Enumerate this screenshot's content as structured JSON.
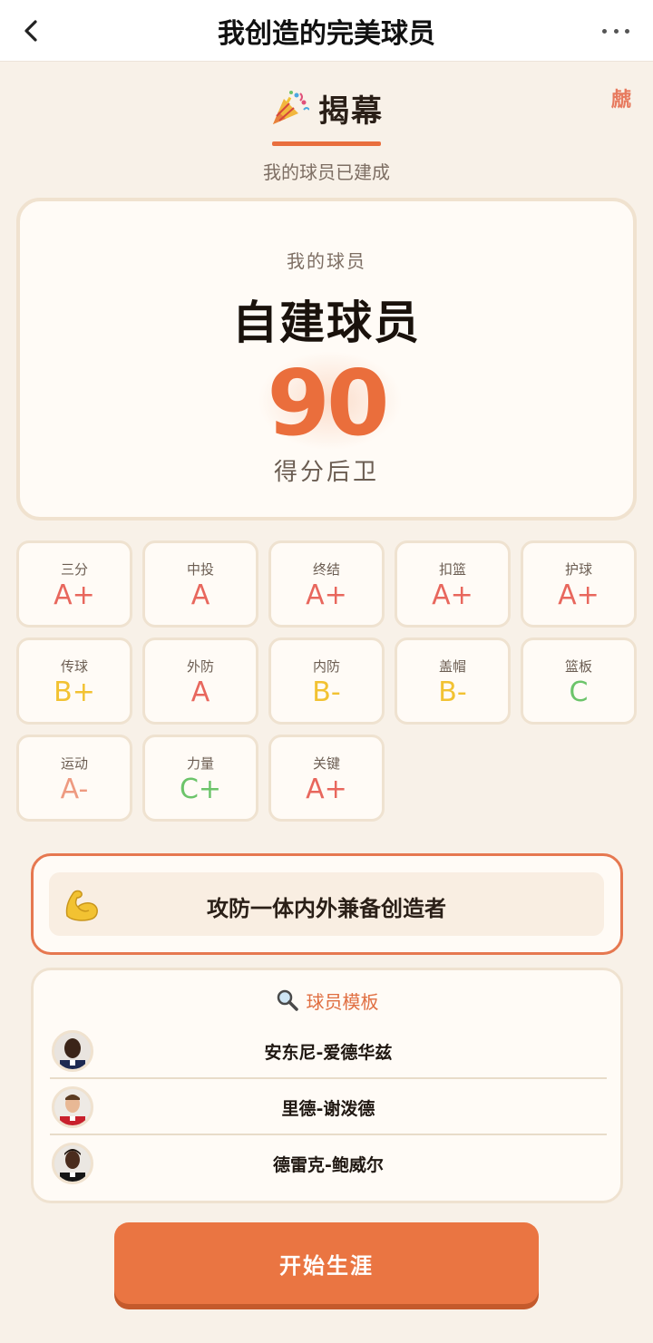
{
  "nav": {
    "title": "我创造的完美球员"
  },
  "reveal": {
    "title": "揭幕",
    "subtitle": "我的球员已建成",
    "corner_stamp": "虤"
  },
  "player_card": {
    "label": "我的球员",
    "name": "自建球员",
    "overall": "90",
    "position": "得分后卫"
  },
  "attributes": [
    {
      "name": "三分",
      "grade": "A+",
      "color": "#e8675d"
    },
    {
      "name": "中投",
      "grade": "A",
      "color": "#e8675d"
    },
    {
      "name": "终结",
      "grade": "A+",
      "color": "#e8675d"
    },
    {
      "name": "扣篮",
      "grade": "A+",
      "color": "#e8675d"
    },
    {
      "name": "护球",
      "grade": "A+",
      "color": "#e8675d"
    },
    {
      "name": "传球",
      "grade": "B+",
      "color": "#f2c232"
    },
    {
      "name": "外防",
      "grade": "A",
      "color": "#e8675d"
    },
    {
      "name": "内防",
      "grade": "B-",
      "color": "#f2c232"
    },
    {
      "name": "盖帽",
      "grade": "B-",
      "color": "#f2c232"
    },
    {
      "name": "篮板",
      "grade": "C",
      "color": "#6cc46a"
    },
    {
      "name": "运动",
      "grade": "A-",
      "color": "#ee9a80"
    },
    {
      "name": "力量",
      "grade": "C+",
      "color": "#6cc46a"
    },
    {
      "name": "关键",
      "grade": "A+",
      "color": "#e8675d"
    }
  ],
  "archetype": {
    "icon": "flexed-biceps-icon",
    "text": "攻防一体内外兼备创造者"
  },
  "templates": {
    "title": "球员模板",
    "players": [
      {
        "name": "安东尼-爱德华兹"
      },
      {
        "name": "里德-谢泼德"
      },
      {
        "name": "德雷克-鲍威尔"
      }
    ]
  },
  "start_button": {
    "label": "开始生涯"
  }
}
